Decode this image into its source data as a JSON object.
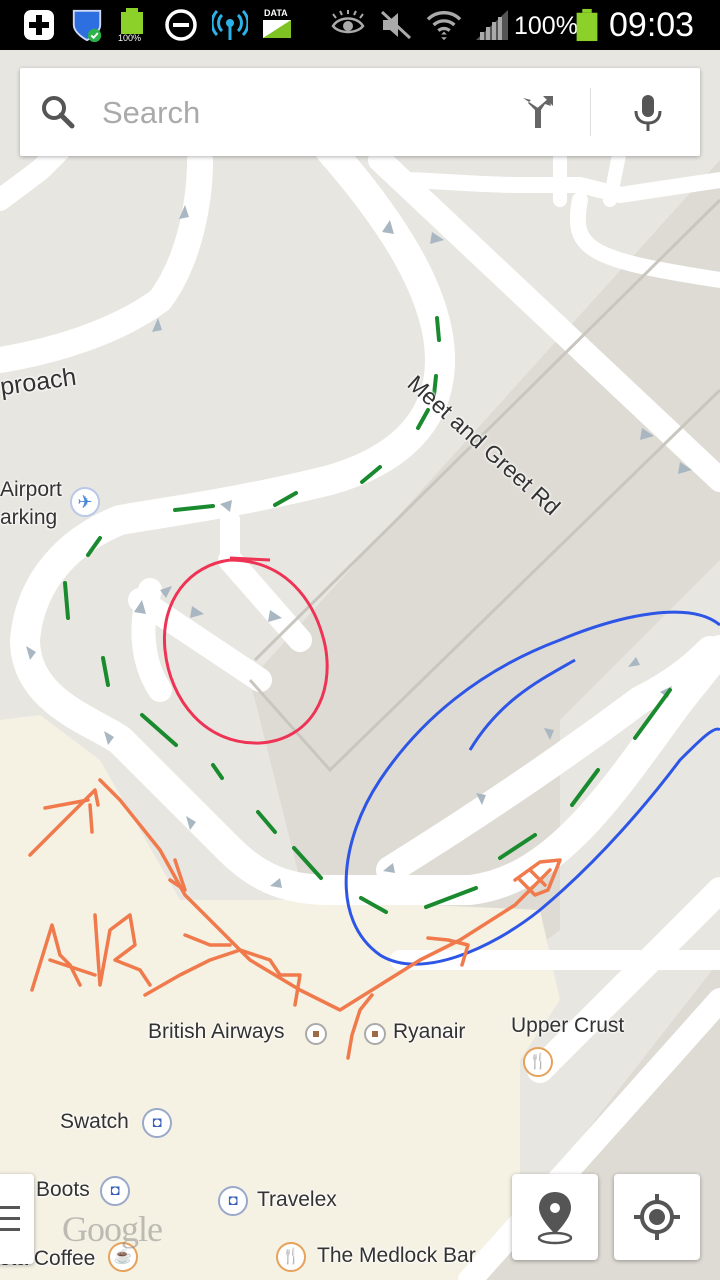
{
  "status_bar": {
    "battery_percent": "100%",
    "time": "09:03",
    "battery_small_label": "100%",
    "data_label": "DATA"
  },
  "search": {
    "placeholder": "Search"
  },
  "map": {
    "road_labels": {
      "meet_greet": "Meet and Greet Rd",
      "approach": "proach"
    },
    "poi": {
      "airport_parking_line1": "Airport",
      "airport_parking_line2": "arking",
      "british_airways": "British Airways",
      "ryanair": "Ryanair",
      "upper_crust": "Upper Crust",
      "swatch": "Swatch",
      "boots": "Boots",
      "travelex": "Travelex",
      "costa_coffee": "sta Coffee",
      "medlock_bar": "The Medlock Bar"
    },
    "watermark": "Google"
  },
  "colors": {
    "map_background": "#e8e6e1",
    "road": "#ffffff",
    "terminal_fill": "#f5f1e3",
    "annotation_green": "#1a8a2e",
    "annotation_red": "#ee3355",
    "annotation_blue": "#2d55e6",
    "annotation_orange": "#f07a4c"
  }
}
